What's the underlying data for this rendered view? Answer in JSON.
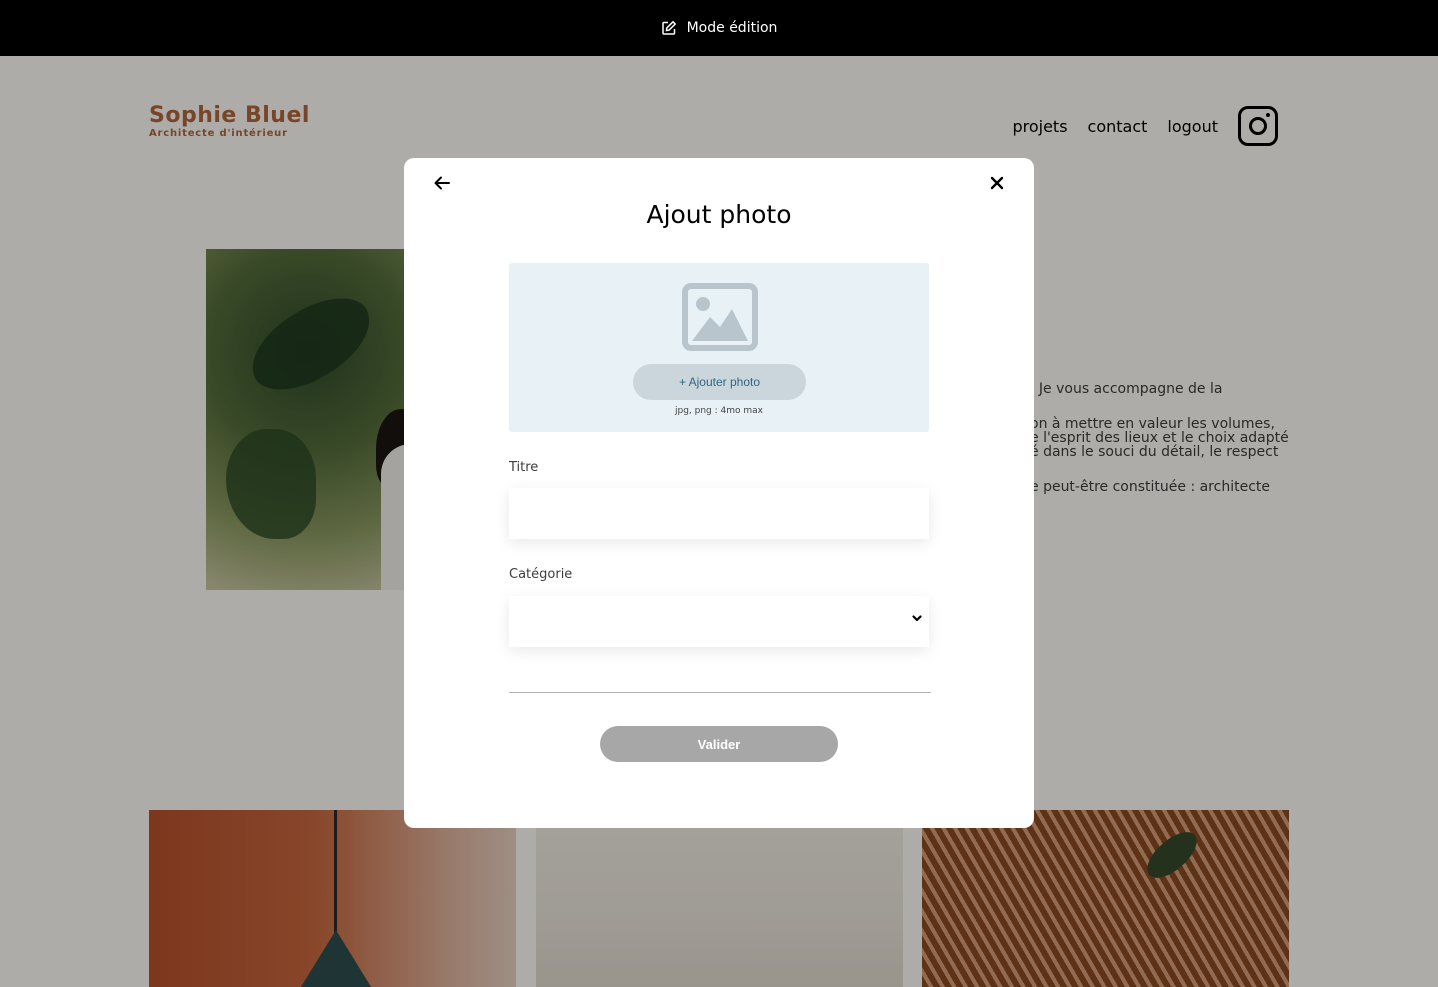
{
  "edit_bar": {
    "icon": "pen-to-square-icon",
    "label": "Mode édition"
  },
  "header": {
    "logo_title": "Sophie Bluel",
    "logo_subtitle": "Architecte d'intérieur",
    "nav": [
      "projets",
      "contact",
      "logout"
    ],
    "social_icon": "instagram-icon"
  },
  "intro": {
    "paragraphs": [
      ". Je vous accompagne de la",
      "on à mettre en valeur les volumes,\ne l'esprit des lieux et le choix adapté\né dans le souci du détail, le respect",
      "e peut-être constituée : architecte"
    ]
  },
  "modal": {
    "back_icon": "arrow-left-icon",
    "close_icon": "close-icon",
    "title": "Ajout photo",
    "upload": {
      "image_icon": "image-icon",
      "add_button": "+ Ajouter photo",
      "hint": "jpg, png : 4mo max"
    },
    "title_field": {
      "label": "Titre",
      "value": ""
    },
    "category_field": {
      "label": "Catégorie",
      "selected": ""
    },
    "submit": "Valider"
  },
  "colors": {
    "brand": "#b1663c",
    "upload_bg": "#e8f1f6",
    "add_button_bg": "#cbd6dc",
    "add_button_text": "#306685",
    "submit_disabled": "#a7a7a7"
  }
}
